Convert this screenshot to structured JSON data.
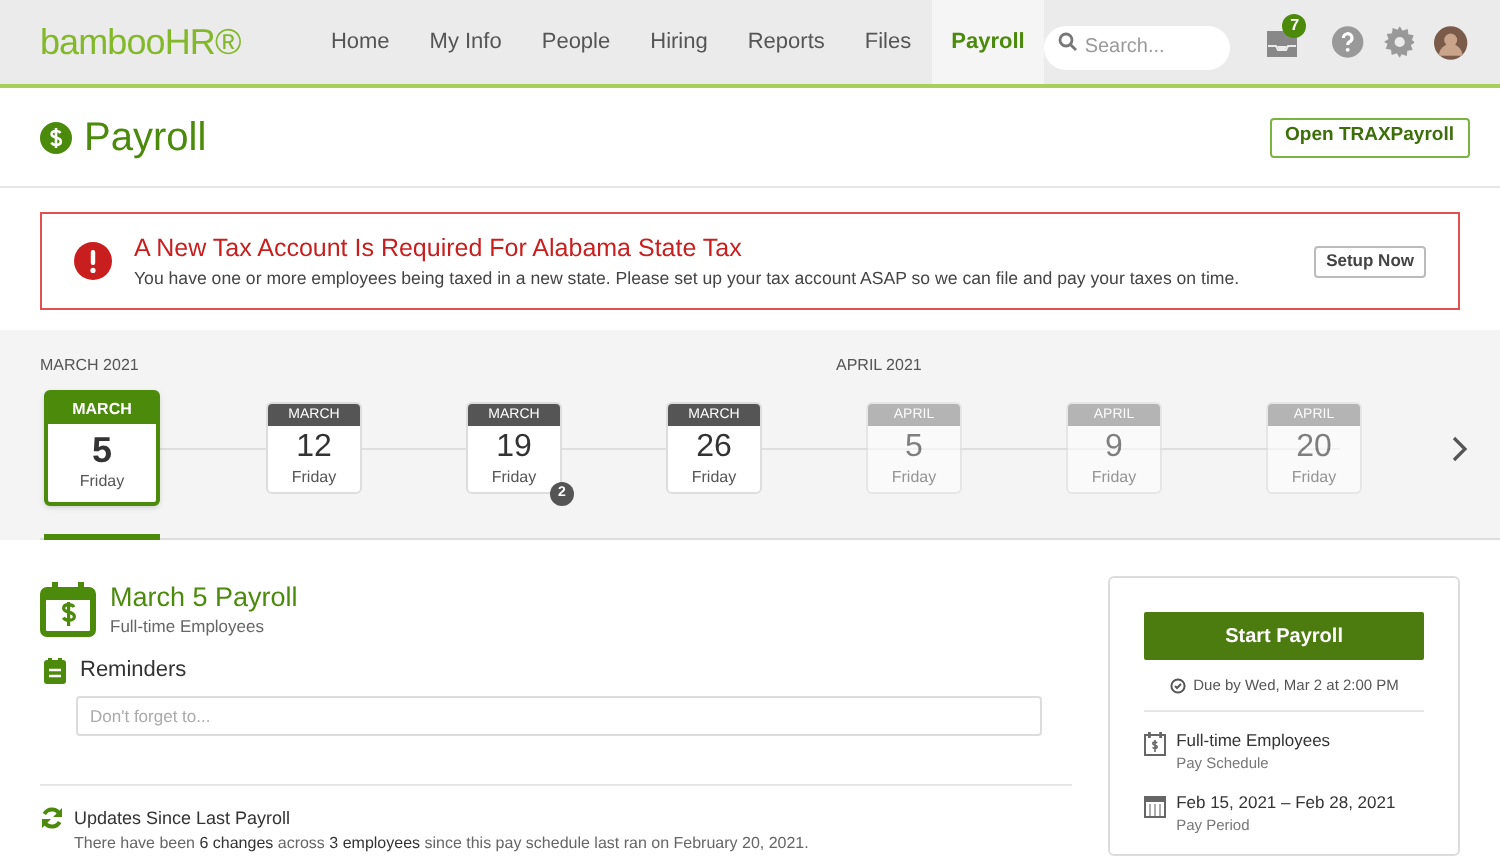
{
  "nav": {
    "logo": "bambooHR®",
    "items": [
      {
        "label": "Home",
        "selected": false
      },
      {
        "label": "My Info",
        "selected": false
      },
      {
        "label": "People",
        "selected": false
      },
      {
        "label": "Hiring",
        "selected": false
      },
      {
        "label": "Reports",
        "selected": false
      },
      {
        "label": "Files",
        "selected": false
      },
      {
        "label": "Payroll",
        "selected": true
      }
    ],
    "search": {
      "placeholder": "Search..."
    },
    "inbox_count": "7"
  },
  "page": {
    "title": "Payroll",
    "action": "Open TRAXPayroll"
  },
  "alert": {
    "title": "A New Tax Account Is Required For Alabama State Tax",
    "message": "You have one or more employees being taxed in a new state. Please set up your tax account ASAP so we can file and pay your taxes on time.",
    "button": "Setup Now"
  },
  "timeline": {
    "months": [
      "MARCH 2021",
      "APRIL 2021"
    ],
    "dates": [
      {
        "month": "MARCH",
        "day": "5",
        "weekday": "Friday",
        "selected": true
      },
      {
        "month": "MARCH",
        "day": "12",
        "weekday": "Friday",
        "selected": false
      },
      {
        "month": "MARCH",
        "day": "19",
        "weekday": "Friday",
        "selected": false,
        "badge": "2"
      },
      {
        "month": "MARCH",
        "day": "26",
        "weekday": "Friday",
        "selected": false
      },
      {
        "month": "APRIL",
        "day": "5",
        "weekday": "Friday",
        "selected": false,
        "dimmed": true
      },
      {
        "month": "APRIL",
        "day": "9",
        "weekday": "Friday",
        "selected": false,
        "dimmed": true
      },
      {
        "month": "APRIL",
        "day": "20",
        "weekday": "Friday",
        "selected": false,
        "dimmed": true
      }
    ]
  },
  "payroll": {
    "title": "March 5 Payroll",
    "subtitle": "Full-time Employees",
    "reminders": {
      "title": "Reminders",
      "placeholder": "Don't forget to..."
    },
    "updates": {
      "title": "Updates Since Last Payroll",
      "text": "There have been **6 changes** across **3 employees** since this pay schedule last ran on February 20, 2021."
    }
  },
  "sidebar": {
    "button": "Start Payroll",
    "due": "Due by Wed, Mar 2 at 2:00 PM",
    "details": [
      {
        "value": "Full-time Employees",
        "label": "Pay Schedule"
      },
      {
        "value": "Feb 15, 2021 – Feb 28, 2021",
        "label": "Pay Period"
      }
    ]
  }
}
